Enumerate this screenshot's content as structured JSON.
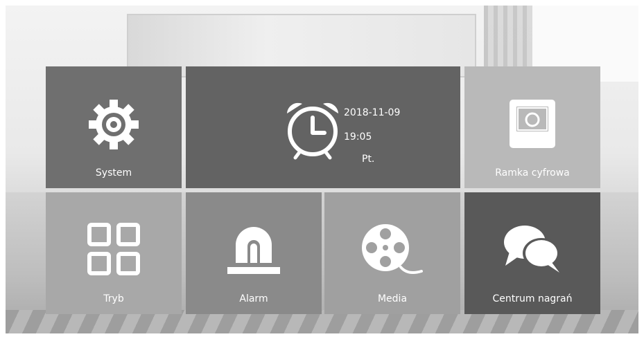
{
  "tiles": {
    "system": {
      "label": "System",
      "icon": "gear-icon"
    },
    "clock": {
      "date": "2018-11-09",
      "time": "19:05",
      "weekday": "Pt.",
      "icon": "alarm-clock-icon"
    },
    "ramka": {
      "label": "Ramka cyfrowa",
      "icon": "photo-frame-icon"
    },
    "tryb": {
      "label": "Tryb",
      "icon": "grid-icon"
    },
    "alarm": {
      "label": "Alarm",
      "icon": "siren-icon"
    },
    "media": {
      "label": "Media",
      "icon": "film-reel-icon"
    },
    "centrum": {
      "label": "Centrum nagrań",
      "icon": "chat-bubbles-icon"
    }
  },
  "colors": {
    "system": "#6f6f6f",
    "clock": "#636363",
    "ramka": "#b9b9b9",
    "tryb": "#a8a8a8",
    "alarm": "#8a8a8a",
    "media": "#a0a0a0",
    "centrum": "#595959"
  }
}
